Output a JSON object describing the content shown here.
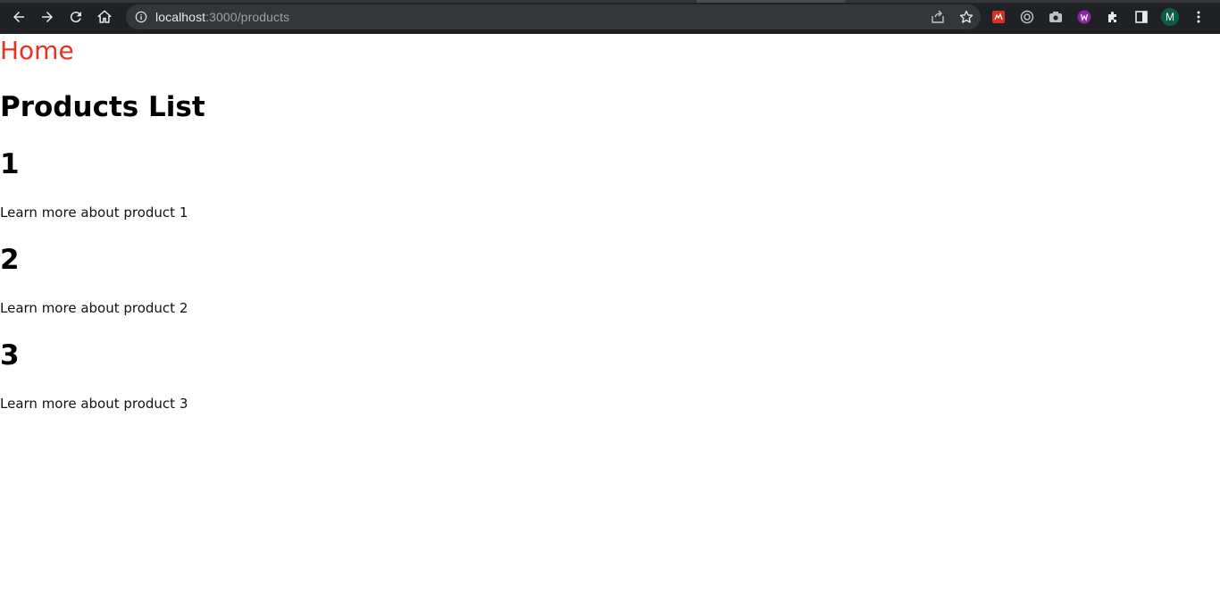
{
  "browser": {
    "url_host": "localhost",
    "url_rest": ":3000/products",
    "avatar_letter": "M",
    "colors": {
      "chrome_bg": "#202124",
      "omnibox_bg": "#35363a",
      "avatar_bg": "#0b5d4a"
    },
    "icons": [
      "back-icon",
      "forward-icon",
      "reload-icon",
      "home-icon",
      "site-info-icon",
      "share-icon",
      "bookmark-star-icon",
      "extension-red-icon",
      "extension-target-icon",
      "extension-camera-icon",
      "extension-purple-icon",
      "extensions-puzzle-icon",
      "side-panel-icon",
      "menu-kebab-icon"
    ]
  },
  "page": {
    "home_link": "Home",
    "home_link_color": "#e8341c",
    "title": "Products List",
    "products": [
      {
        "number": "1",
        "link_text": "Learn more about product 1"
      },
      {
        "number": "2",
        "link_text": "Learn more about product 2"
      },
      {
        "number": "3",
        "link_text": "Learn more about product 3"
      }
    ]
  }
}
